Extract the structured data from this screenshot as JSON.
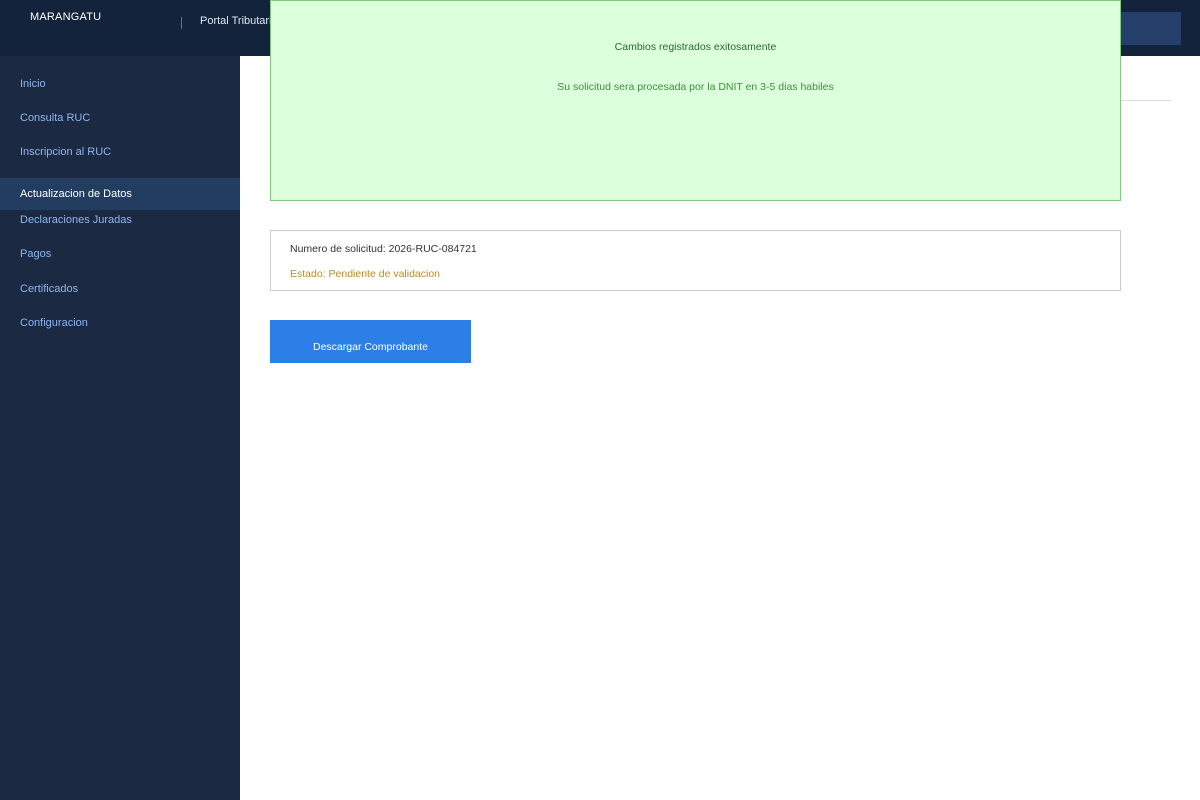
{
  "header": {
    "brand": "MARANGATU",
    "portal_title": "Portal Tributario"
  },
  "sidebar": {
    "items": [
      {
        "label": "Inicio"
      },
      {
        "label": "Consulta RUC"
      },
      {
        "label": "Inscripcion al RUC"
      },
      {
        "label": "Actualizacion de Datos",
        "active": true
      },
      {
        "label": "Declaraciones Juradas"
      },
      {
        "label": "Pagos"
      },
      {
        "label": "Certificados"
      },
      {
        "label": "Configuracion"
      }
    ]
  },
  "banner": {
    "title": "Cambios registrados exitosamente",
    "message": "Su solicitud sera procesada por la DNIT en 3-5 dias habiles"
  },
  "request": {
    "number_text": "Numero de solicitud: 2026-RUC-084721",
    "status_text": "Estado: Pendiente de validacion"
  },
  "actions": {
    "download_label": "Descargar Comprobante"
  },
  "colors": {
    "header_bg": "#14233c",
    "sidebar_bg": "#1c2942",
    "sidebar_active_bg": "#233d60",
    "banner_bg": "#dcffdc",
    "status_color": "#bf8a1f",
    "button_bg": "#2b7fe6"
  }
}
